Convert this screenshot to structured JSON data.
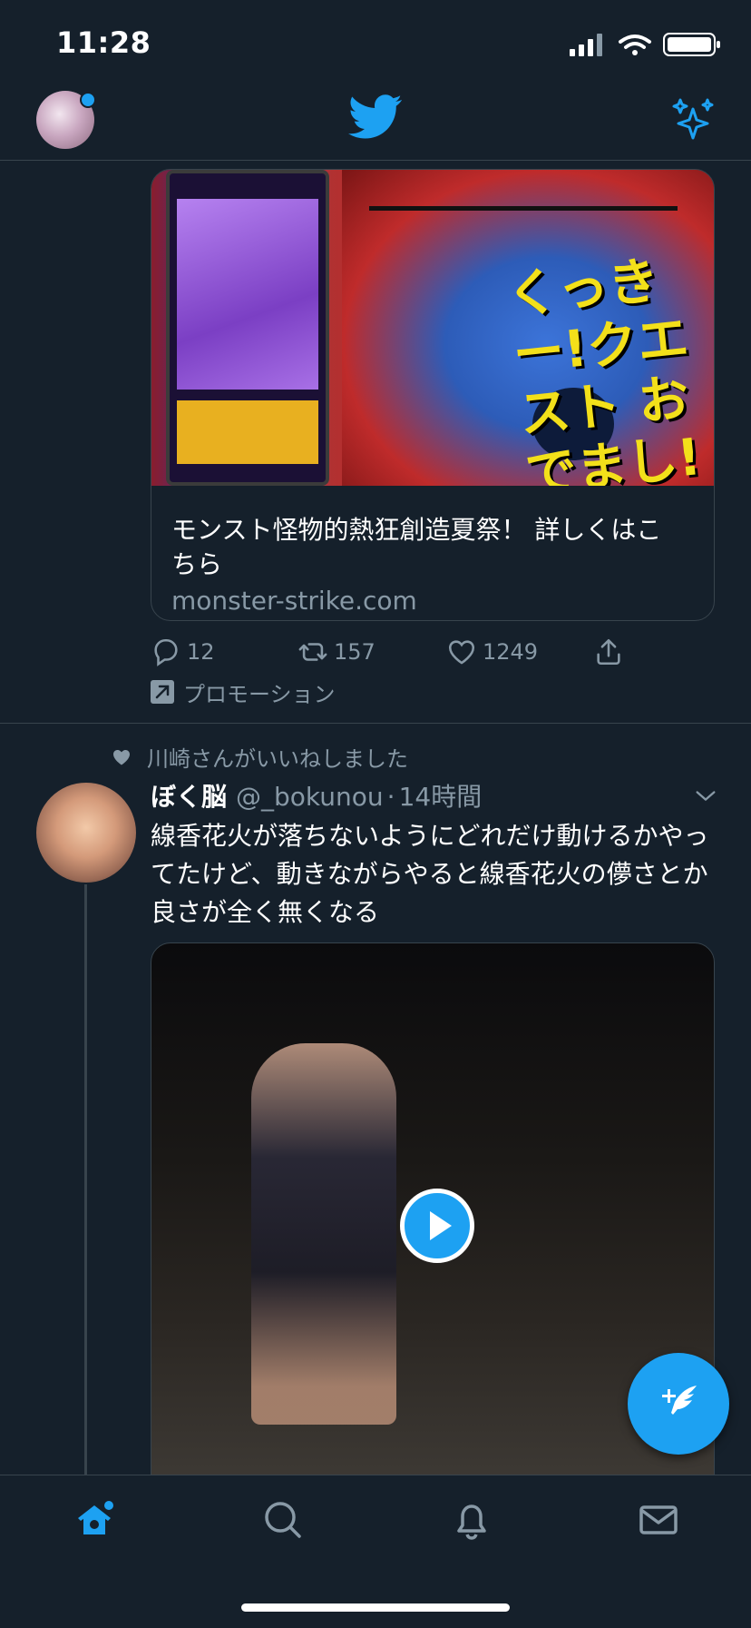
{
  "status_bar": {
    "time": "11:28"
  },
  "promo_card": {
    "image_caption": "くっきー!クエスト おでまし!",
    "title": "モンスト怪物的熱狂創造夏祭！ 詳しくはこちら",
    "domain": "monster-strike.com",
    "actions": {
      "replies": "12",
      "retweets": "157",
      "likes": "1249"
    },
    "promoted_label": "プロモーション"
  },
  "tweet": {
    "liked_by": "川崎さんがいいねしました",
    "name": "ぼく脳",
    "handle": "@_bokunou",
    "separator": "·",
    "time": "14時間",
    "text": "線香花火が落ちないようにどれだけ動けるかやってたけど、動きながらやると線香花火の儚さとか良さが全く無くなる"
  },
  "colors": {
    "background": "#15202b",
    "accent": "#1da1f2",
    "muted": "#8899a6",
    "divider": "#38444d"
  },
  "icons": [
    "home-icon",
    "search-icon",
    "bell-icon",
    "mail-icon",
    "compose-icon",
    "twitter-logo-icon",
    "sparkle-icon"
  ]
}
